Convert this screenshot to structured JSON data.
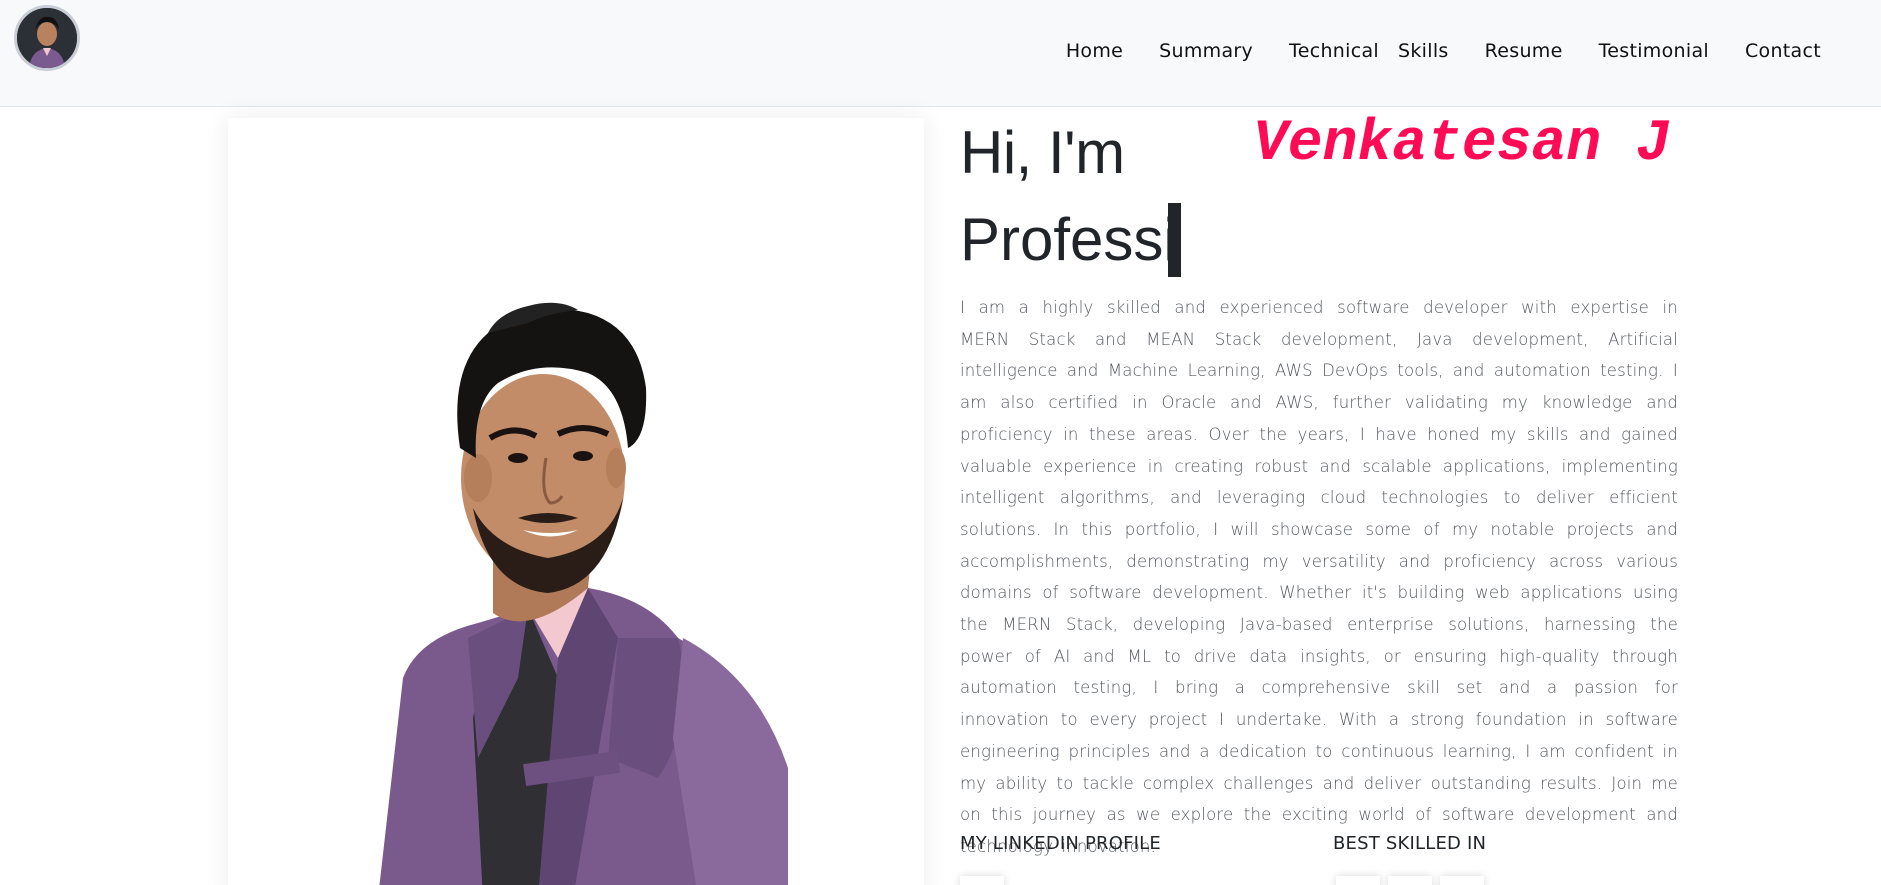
{
  "header": {
    "nav": [
      {
        "label": "Home"
      },
      {
        "label": "Summary"
      },
      {
        "label": "Technical   Skills"
      },
      {
        "label": "Resume"
      },
      {
        "label": "Testimonial"
      },
      {
        "label": "Contact"
      }
    ]
  },
  "intro": {
    "greeting": "Hi, I'm",
    "name": "Venkatesan J",
    "typed_text": "Professi",
    "bio": "I am a highly skilled and experienced software developer with expertise in MERN Stack and MEAN Stack development, Java development, Artificial intelligence and Machine Learning, AWS DevOps tools, and automation testing. I am also certified in Oracle and AWS, further validating my knowledge and proficiency in these areas. Over the years, I have honed my skills and gained valuable experience in creating robust and scalable applications, implementing intelligent algorithms, and leveraging cloud technologies to deliver efficient solutions. In this portfolio, I will showcase some of my notable projects and accomplishments, demonstrating my versatility and proficiency across various domains of software development. Whether it's building web applications using the MERN Stack, developing Java-based enterprise solutions, harnessing the power of AI and ML to drive data insights, or ensuring high-quality through automation testing, I bring a comprehensive skill set and a passion for innovation to every project I undertake. With a strong foundation in software engineering principles and a dedication to continuous learning, I am confident in my ability to tackle complex challenges and deliver outstanding results. Join me on this journey as we explore the exciting world of software development and technology innovation."
  },
  "sections": {
    "linkedin_heading": "MY LINKEDIN PROFILE",
    "skills_heading": "BEST SKILLED IN"
  },
  "colors": {
    "accent": "#ff0a54",
    "header_bg": "#f8f9fa",
    "text": "#212529"
  }
}
